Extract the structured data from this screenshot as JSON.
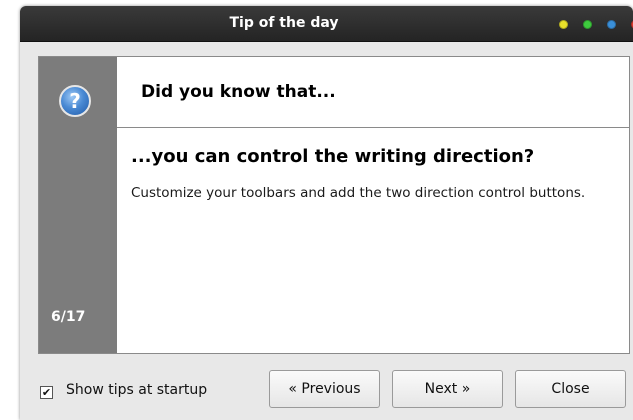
{
  "window": {
    "title": "Tip of the day",
    "buttons": [
      {
        "name": "minimize",
        "color": "#e8e02a"
      },
      {
        "name": "maximize",
        "color": "#3ecb3e"
      },
      {
        "name": "shade",
        "color": "#3a8fd8"
      },
      {
        "name": "close",
        "color": "#e23b2e"
      }
    ]
  },
  "panel": {
    "icon": "help-icon",
    "counter": "6/17",
    "header": "Did you know that...",
    "tip_title": "...you can control the writing direction?",
    "tip_body": "Customize your toolbars and add the two direction control buttons."
  },
  "footer": {
    "show_tips_label": "Show tips at startup",
    "show_tips_checked": true,
    "previous_label": "« Previous",
    "next_label": "Next »",
    "close_label": "Close"
  },
  "colors": {
    "titlebar": "#2e2e2e",
    "sidebar": "#7c7c7c",
    "background": "#e8e8e8"
  }
}
